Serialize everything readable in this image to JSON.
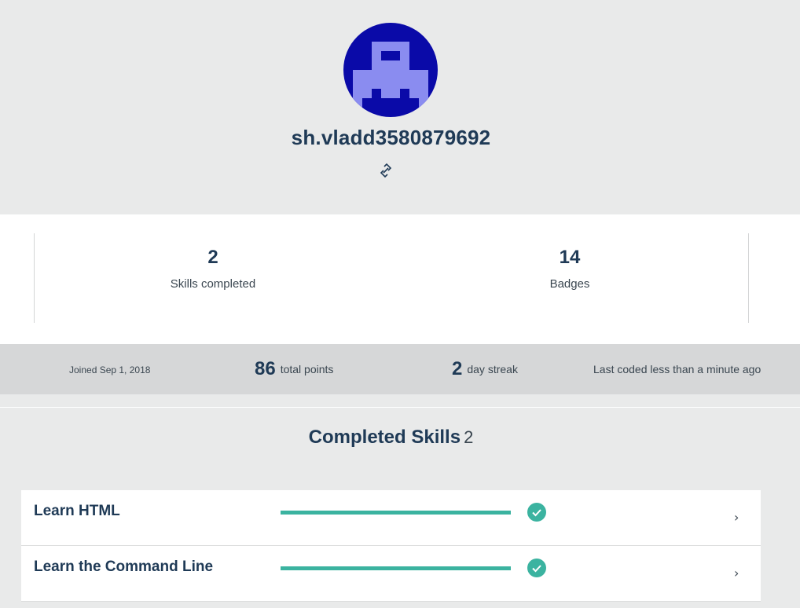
{
  "profile": {
    "username": "sh.vladd3580879692",
    "avatar_icon": "pixel-robot-avatar-icon",
    "avatar_colors": {
      "background": "#0a0aa8",
      "figure": "#8a8cf0"
    },
    "share_icon": "link-icon"
  },
  "stats": {
    "skills_completed": {
      "value": "2",
      "label": "Skills completed"
    },
    "badges": {
      "value": "14",
      "label": "Badges"
    }
  },
  "info_bar": {
    "joined": "Joined Sep 1, 2018",
    "points": {
      "value": "86",
      "label": "total points"
    },
    "streak": {
      "value": "2",
      "label": "day streak"
    },
    "last_coded": "Last coded less than a minute ago"
  },
  "completed_skills": {
    "title": "Completed Skills",
    "count": "2",
    "items": [
      {
        "name": "Learn HTML",
        "progress": 1.0,
        "completed": true,
        "chevron": "›"
      },
      {
        "name": "Learn the Command Line",
        "progress": 1.0,
        "completed": true,
        "chevron": "›"
      }
    ]
  },
  "colors": {
    "accent": "#3bb3a0",
    "text_dark": "#1f3a56",
    "page_bg": "#e9eaea",
    "info_bar_bg": "#d6d7d8"
  }
}
